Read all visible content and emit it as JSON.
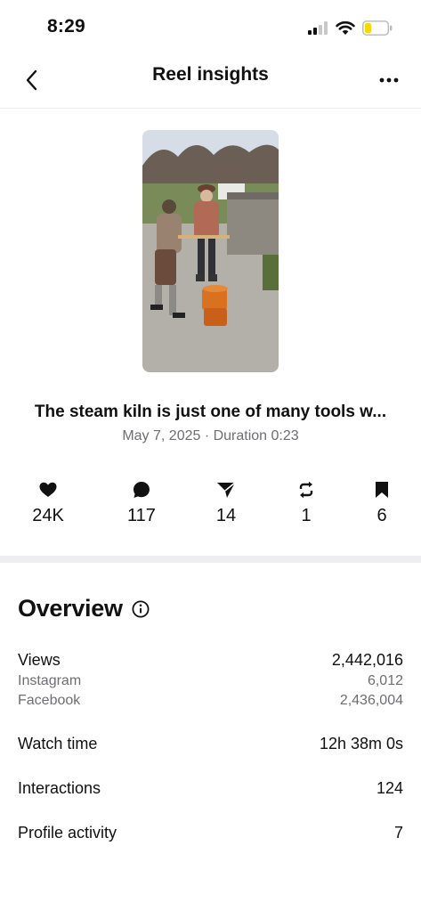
{
  "status_bar": {
    "time": "8:29"
  },
  "nav": {
    "title": "Reel insights"
  },
  "reel": {
    "caption": "The steam kiln is just one of many tools w...",
    "meta": "May 7, 2025 · Duration 0:23"
  },
  "stats": [
    {
      "icon": "heart-icon",
      "value": "24K"
    },
    {
      "icon": "comment-icon",
      "value": "117"
    },
    {
      "icon": "share-icon",
      "value": "14"
    },
    {
      "icon": "repost-icon",
      "value": "1"
    },
    {
      "icon": "bookmark-icon",
      "value": "6"
    }
  ],
  "overview": {
    "title": "Overview",
    "views": {
      "label": "Views",
      "value": "2,442,016"
    },
    "instagram": {
      "label": "Instagram",
      "value": "6,012"
    },
    "facebook": {
      "label": "Facebook",
      "value": "2,436,004"
    },
    "watch_time": {
      "label": "Watch time",
      "value": "12h 38m 0s"
    },
    "interactions": {
      "label": "Interactions",
      "value": "124"
    },
    "profile_activity": {
      "label": "Profile activity",
      "value": "7"
    }
  },
  "colors": {
    "text": "#111111",
    "secondary": "#6e6e73",
    "divider": "#eeeef0",
    "battery_low": "#f5d90a"
  }
}
